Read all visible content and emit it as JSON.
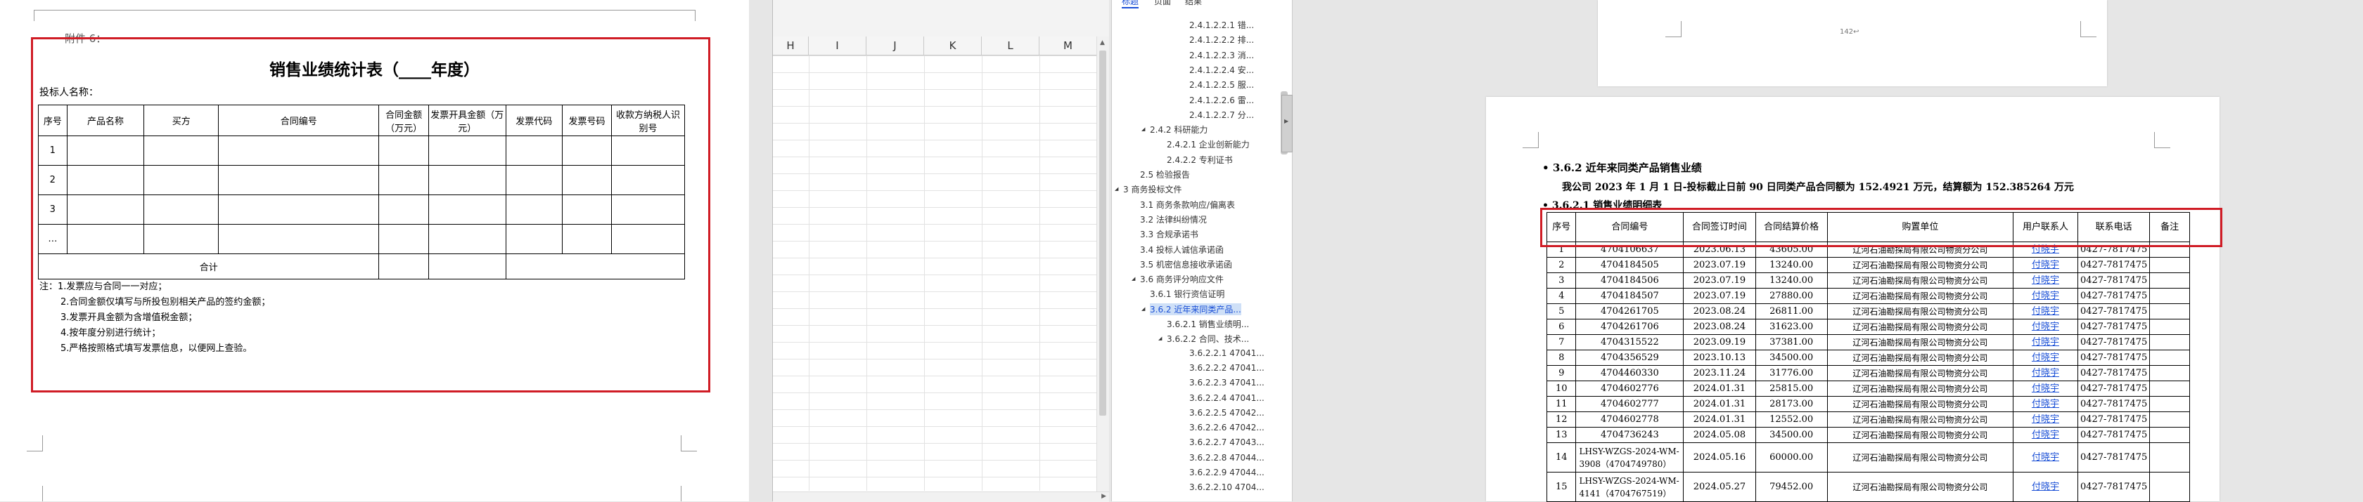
{
  "left_doc": {
    "header": "附件 6：",
    "title": "销售业绩统计表（____年度）",
    "bidder_label": "投标人名称：",
    "columns": [
      "序号",
      "产品名称",
      "买方",
      "合同编号",
      "合同金额（万元）",
      "发票开具金额（万元）",
      "发票代码",
      "发票号码",
      "收款方纳税人识别号"
    ],
    "row_numbers": [
      "1",
      "2",
      "3",
      "…"
    ],
    "total_label": "合计",
    "notes": [
      "注：1.发票应与合同一一对应；",
      "2.合同金额仅填写与所投包别相关产品的签约金额；",
      "3.发票开具金额为含增值税金额；",
      "4.按年度分别进行统计；",
      "5.严格按照格式填写发票信息，以便网上查验。"
    ]
  },
  "spreadsheet": {
    "columns": [
      "H",
      "I",
      "J",
      "K",
      "L",
      "M"
    ]
  },
  "nav_pane": {
    "tabs": [
      "标题",
      "页面",
      "结果"
    ],
    "items": [
      {
        "label": "2.4.1.2.2.1 错...",
        "indent": 3
      },
      {
        "label": "2.4.1.2.2.2 排...",
        "indent": 3
      },
      {
        "label": "2.4.1.2.2.3 消...",
        "indent": 3
      },
      {
        "label": "2.4.1.2.2.4 安...",
        "indent": 3
      },
      {
        "label": "2.4.1.2.2.5 服...",
        "indent": 3
      },
      {
        "label": "2.4.1.2.2.6 雷...",
        "indent": 3
      },
      {
        "label": "2.4.1.2.2.7 分...",
        "indent": 3
      },
      {
        "label": "2.4.2 科研能力",
        "indent": 1
      },
      {
        "label": "2.4.2.1 企业创新能力",
        "indent": 2
      },
      {
        "label": "2.4.2.2 专利证书",
        "indent": 2
      },
      {
        "label": "2.5 检验报告",
        "indent": 0
      },
      {
        "label": "3 商务投标文件",
        "indent": -1
      },
      {
        "label": "3.1 商务条款响应/偏离表",
        "indent": 0
      },
      {
        "label": "3.2 法律纠纷情况",
        "indent": 0
      },
      {
        "label": "3.3 合规承诺书",
        "indent": 0
      },
      {
        "label": "3.4 投标人诚信承诺函",
        "indent": 0
      },
      {
        "label": "3.5 机密信息接收承诺函",
        "indent": 0
      },
      {
        "label": "3.6 商务评分响应文件",
        "indent": 0
      },
      {
        "label": "3.6.1 银行资信证明",
        "indent": 1
      },
      {
        "label": "3.6.2 近年来同类产品...",
        "indent": 1
      },
      {
        "label": "3.6.2.1 销售业绩明...",
        "indent": 2
      },
      {
        "label": "3.6.2.2 合同、技术...",
        "indent": 2
      },
      {
        "label": "3.6.2.2.1 47041...",
        "indent": 3
      },
      {
        "label": "3.6.2.2.2 47041...",
        "indent": 3
      },
      {
        "label": "3.6.2.2.3 47041...",
        "indent": 3
      },
      {
        "label": "3.6.2.2.4 47041...",
        "indent": 3
      },
      {
        "label": "3.6.2.2.5 47042...",
        "indent": 3
      },
      {
        "label": "3.6.2.2.6 47042...",
        "indent": 3
      },
      {
        "label": "3.6.2.2.7 47043...",
        "indent": 3
      },
      {
        "label": "3.6.2.2.8 47044...",
        "indent": 3
      },
      {
        "label": "3.6.2.2.9 47044...",
        "indent": 3
      },
      {
        "label": "3.6.2.2.10 4704...",
        "indent": 3
      }
    ]
  },
  "right_doc": {
    "top_page_mark": "142↩",
    "heading": "3.6.2  近年来同类产品销售业绩",
    "summary": "我公司 2023 年 1 月 1 日-投标截止日前 90 日同类产品合同额为 152.4921 万元，结算额为 152.385264 万元",
    "subheading": "3.6.2.1 销售业绩明细表",
    "columns": [
      "序号",
      "合同编号",
      "合同签订时间",
      "合同结算价格",
      "购置单位",
      "用户联系人",
      "联系电话",
      "备注"
    ],
    "rows": [
      [
        "1",
        "4704106637",
        "2023.06.13",
        "43605.00",
        "辽河石油勘探局有限公司物资分公司",
        "付晓宇",
        "0427-7817475",
        ""
      ],
      [
        "2",
        "4704184505",
        "2023.07.19",
        "13240.00",
        "辽河石油勘探局有限公司物资分公司",
        "付晓宇",
        "0427-7817475",
        ""
      ],
      [
        "3",
        "4704184506",
        "2023.07.19",
        "13240.00",
        "辽河石油勘探局有限公司物资分公司",
        "付晓宇",
        "0427-7817475",
        ""
      ],
      [
        "4",
        "4704184507",
        "2023.07.19",
        "27880.00",
        "辽河石油勘探局有限公司物资分公司",
        "付晓宇",
        "0427-7817475",
        ""
      ],
      [
        "5",
        "4704261705",
        "2023.08.24",
        "26811.00",
        "辽河石油勘探局有限公司物资分公司",
        "付晓宇",
        "0427-7817475",
        ""
      ],
      [
        "6",
        "4704261706",
        "2023.08.24",
        "31623.00",
        "辽河石油勘探局有限公司物资分公司",
        "付晓宇",
        "0427-7817475",
        ""
      ],
      [
        "7",
        "4704315522",
        "2023.09.19",
        "37381.00",
        "辽河石油勘探局有限公司物资分公司",
        "付晓宇",
        "0427-7817475",
        ""
      ],
      [
        "8",
        "4704356529",
        "2023.10.13",
        "34500.00",
        "辽河石油勘探局有限公司物资分公司",
        "付晓宇",
        "0427-7817475",
        ""
      ],
      [
        "9",
        "4704460330",
        "2023.11.24",
        "31776.00",
        "辽河石油勘探局有限公司物资分公司",
        "付晓宇",
        "0427-7817475",
        ""
      ],
      [
        "10",
        "4704602776",
        "2024.01.31",
        "25815.00",
        "辽河石油勘探局有限公司物资分公司",
        "付晓宇",
        "0427-7817475",
        ""
      ],
      [
        "11",
        "4704602777",
        "2024.01.31",
        "28173.00",
        "辽河石油勘探局有限公司物资分公司",
        "付晓宇",
        "0427-7817475",
        ""
      ],
      [
        "12",
        "4704602778",
        "2024.01.31",
        "12552.00",
        "辽河石油勘探局有限公司物资分公司",
        "付晓宇",
        "0427-7817475",
        ""
      ],
      [
        "13",
        "4704736243",
        "2024.05.08",
        "34500.00",
        "辽河石油勘探局有限公司物资分公司",
        "付晓宇",
        "0427-7817475",
        ""
      ],
      [
        "14",
        "LHSY-WZGS-2024-WM-3908（4704749780）",
        "2024.05.16",
        "60000.00",
        "辽河石油勘探局有限公司物资分公司",
        "付晓宇",
        "0427-7817475",
        ""
      ],
      [
        "15",
        "LHSY-WZGS-2024-WM-4141（4704767519）",
        "2024.05.27",
        "79452.00",
        "辽河石油勘探局有限公司物资分公司",
        "付晓宇",
        "0427-7817475",
        ""
      ]
    ]
  },
  "colors": {
    "highlight": "#d01c25",
    "link": "#1a4fd6",
    "nav_selected": "#cfe0f7",
    "workspace": "#e6e6e6"
  }
}
